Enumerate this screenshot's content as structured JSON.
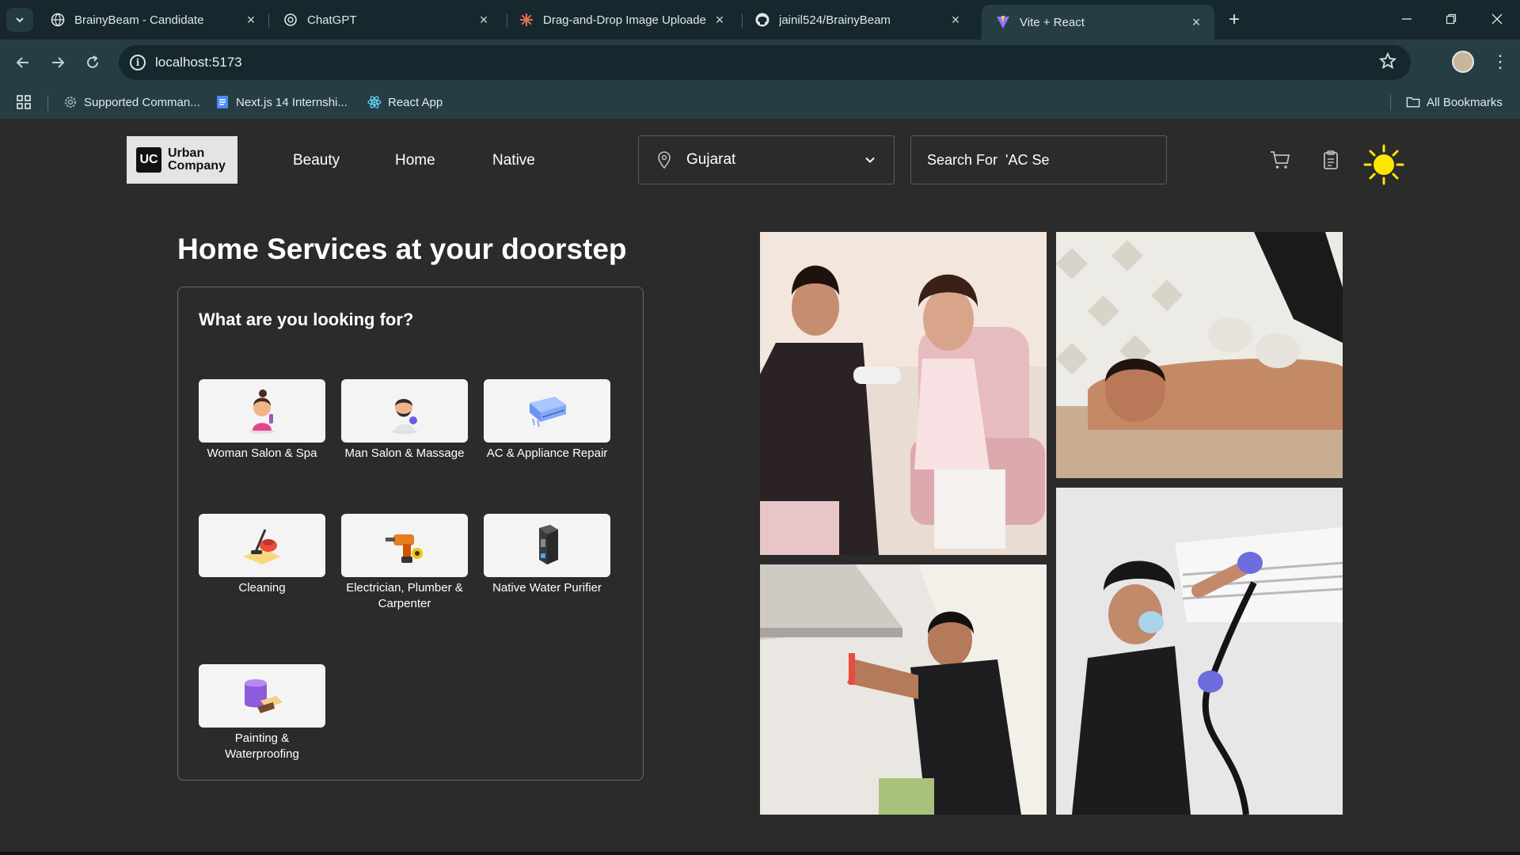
{
  "browser": {
    "tabs": [
      {
        "title": "BrainyBeam - Candidate",
        "favicon": "globe-icon"
      },
      {
        "title": "ChatGPT",
        "favicon": "openai-icon"
      },
      {
        "title": "Drag-and-Drop Image Uploade",
        "favicon": "claude-icon"
      },
      {
        "title": "jainil524/BrainyBeam",
        "favicon": "github-icon"
      },
      {
        "title": "Vite + React",
        "favicon": "vite-icon"
      }
    ],
    "url": "localhost:5173",
    "bookmarks": [
      {
        "label": "Supported Comman...",
        "icon": "gear-icon"
      },
      {
        "label": "Next.js 14 Internshi...",
        "icon": "doc-icon"
      },
      {
        "label": "React App",
        "icon": "react-icon"
      }
    ],
    "all_bookmarks": "All Bookmarks"
  },
  "header": {
    "logo_line1": "Urban",
    "logo_line2": "Company",
    "logo_badge": "UC",
    "nav": [
      "Beauty",
      "Home",
      "Native"
    ],
    "location": "Gujarat",
    "search_text": "Search For  'AC Se"
  },
  "hero": {
    "title": "Home Services at your doorstep",
    "panel_title": "What are you looking for?",
    "services": [
      {
        "label": "Woman Salon & Spa",
        "icon": "woman-salon-icon"
      },
      {
        "label": "Man Salon & Massage",
        "icon": "man-salon-icon"
      },
      {
        "label": "AC & Appliance Repair",
        "icon": "ac-icon"
      },
      {
        "label": "Cleaning",
        "icon": "vacuum-icon"
      },
      {
        "label": "Electrician, Plumber & Carpenter",
        "icon": "drill-icon"
      },
      {
        "label": "Native Water Purifier",
        "icon": "water-purifier-icon"
      },
      {
        "label": "Painting & Waterproofing",
        "icon": "paint-icon"
      }
    ]
  },
  "colors": {
    "page_bg": "#2b2b2b",
    "chrome_dark": "#16282e",
    "chrome_mid": "#273d44",
    "sun": "#ffe600"
  }
}
